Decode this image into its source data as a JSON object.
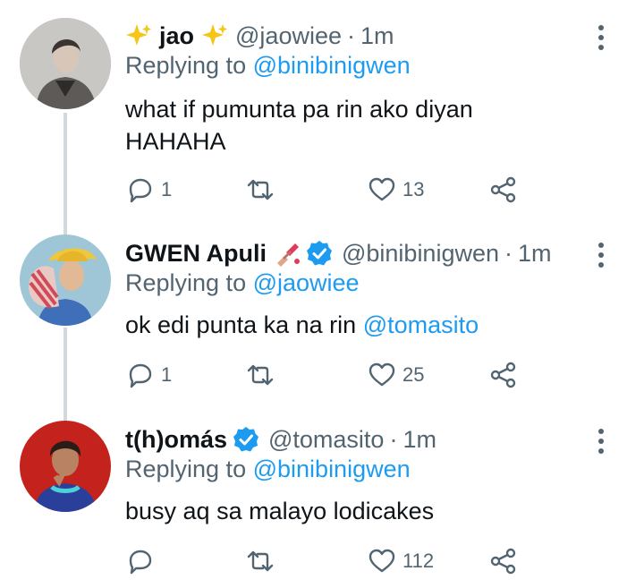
{
  "colors": {
    "accent": "#1d9bf0",
    "secondary_text": "#536471",
    "primary_text": "#0f1419",
    "thread_line": "#cfd9de"
  },
  "tweets": [
    {
      "name": "jao",
      "name_decoration": "sparkles",
      "verified": false,
      "handle": "@jaowiee",
      "separator": "·",
      "time": "1m",
      "replying_prefix": "Replying to",
      "replying_to": "@binibinigwen",
      "text_line1": "what if pumunta pa rin ako diyan",
      "text_line2": "HAHAHA",
      "replies": "1",
      "retweets": "",
      "likes": "13"
    },
    {
      "name": "GWEN Apuli",
      "name_decoration": "nail-polish",
      "verified": true,
      "handle": "@binibinigwen",
      "separator": "·",
      "time": "1m",
      "replying_prefix": "Replying to",
      "replying_to": "@jaowiee",
      "text": "ok edi punta ka na rin",
      "mention": "@tomasito",
      "replies": "1",
      "retweets": "",
      "likes": "25"
    },
    {
      "name": "t(h)omás",
      "verified": true,
      "handle": "@tomasito",
      "separator": "·",
      "time": "1m",
      "replying_prefix": "Replying to",
      "replying_to": "@binibinigwen",
      "text": "busy aq sa malayo lodicakes",
      "replies": "",
      "retweets": "",
      "likes": "112"
    }
  ]
}
